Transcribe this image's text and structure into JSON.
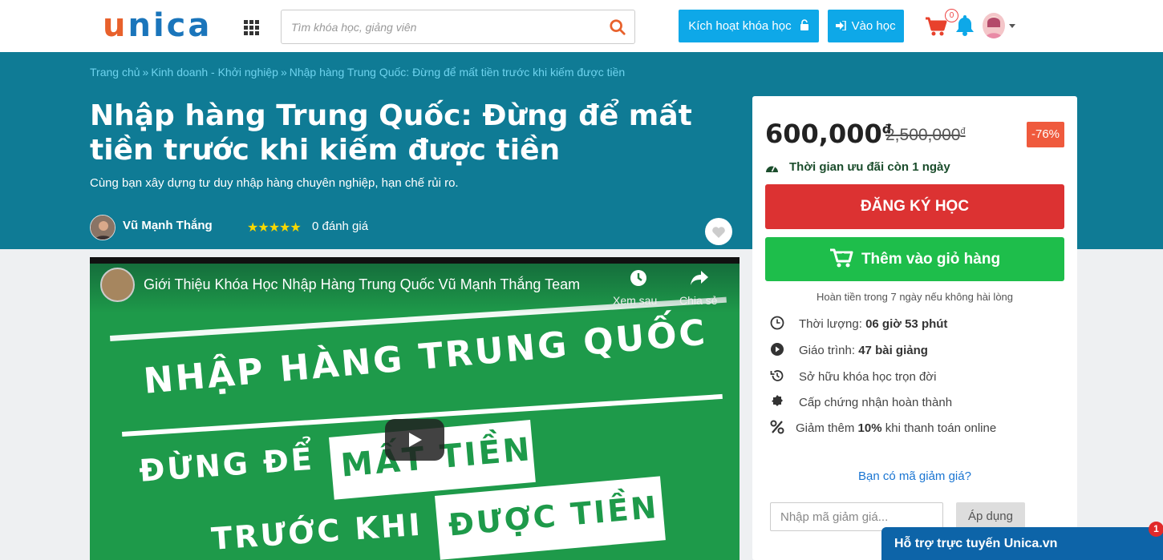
{
  "header": {
    "logo": "unica",
    "search_placeholder": "Tìm khóa học, giảng viên",
    "activate_label": "Kích hoạt khóa học",
    "learn_label": "Vào học",
    "cart_count": "0"
  },
  "breadcrumb": [
    "Trang chủ",
    "Kinh doanh - Khởi nghiệp",
    "Nhập hàng Trung Quốc: Đừng để mất tiền trước khi kiếm được tiền"
  ],
  "breadcrumb_separator": "»",
  "course": {
    "title": "Nhập hàng Trung Quốc: Đừng để mất tiền trước khi kiếm được tiền",
    "subtitle": "Cùng bạn xây dựng tư duy nhập hàng chuyên nghiệp, hạn chế rủi ro.",
    "author": "Vũ Mạnh Thắng",
    "rating_stars": 5,
    "reviews": "0 đánh giá"
  },
  "video": {
    "title": "Giới Thiệu Khóa Học Nhập Hàng Trung Quốc Vũ Mạnh Thắng Team",
    "watch_later": "Xem sau",
    "share": "Chia sẻ",
    "line1": "NHẬP HÀNG TRUNG QUỐC",
    "line2": "ĐỪNG ĐỂ",
    "box1": "MẤT TIỀN",
    "line3": "TRƯỚC KHI",
    "box2": "ĐƯỢC TIỀN"
  },
  "pricing": {
    "price": "600,000",
    "old_price": "2,500,000",
    "currency": "đ",
    "discount": "-76%",
    "deadline": "Thời gian ưu đãi còn 1 ngày",
    "register_label": "ĐĂNG KÝ HỌC",
    "add_cart_label": "Thêm vào giỏ hàng",
    "refund_note": "Hoàn tiền trong 7 ngày nếu không hài lòng"
  },
  "features": {
    "duration_label": "Thời lượng:",
    "duration_value": "06 giờ 53 phút",
    "lessons_label": "Giáo trình:",
    "lessons_value": "47 bài giảng",
    "lifetime": "Sở hữu khóa học trọn đời",
    "certificate": "Cấp chứng nhận hoàn thành",
    "discount_pre": "Giảm thêm",
    "discount_value": "10%",
    "discount_post": "khi thanh toán online"
  },
  "coupon": {
    "link": "Bạn có mã giảm giá?",
    "placeholder": "Nhập mã giảm giá...",
    "apply_label": "Áp dụng"
  },
  "support": {
    "label": "Hỗ trợ trực tuyến Unica.vn",
    "badge": "1"
  },
  "colors": {
    "hero_bg": "#0f7b95",
    "primary_blue": "#0ea8e8",
    "register_red": "#dc3232",
    "cart_green": "#1ebe4b",
    "discount_orange": "#ef5a3d",
    "video_green": "#1e9a4a"
  }
}
